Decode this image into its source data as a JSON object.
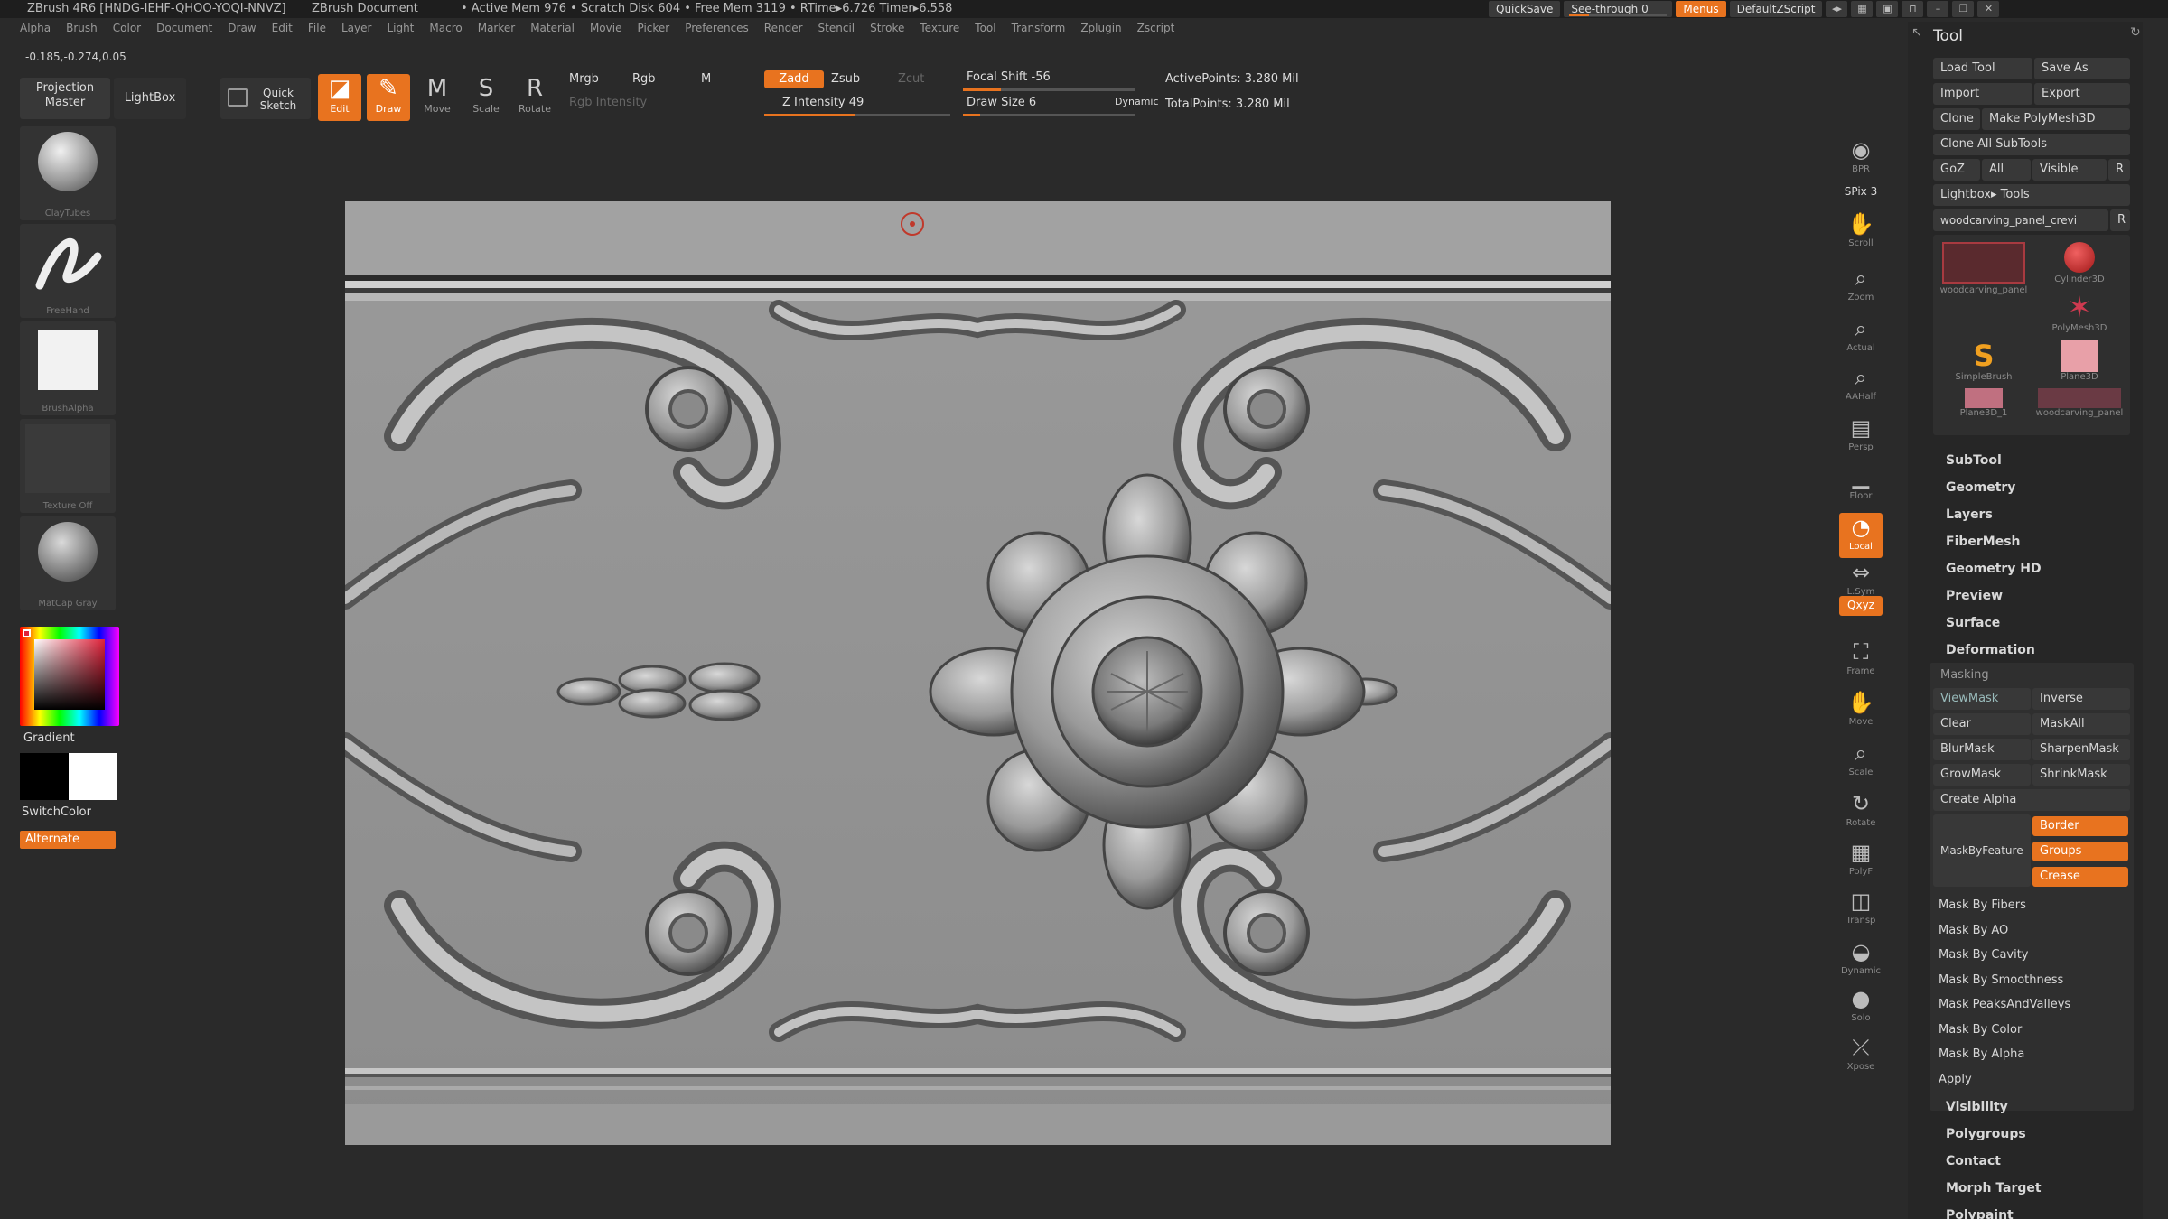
{
  "titlebar": {
    "app": "ZBrush 4R6 [HNDG-IEHF-QHOO-YOQI-NNVZ]",
    "document": "ZBrush Document",
    "memory": "• Active Mem 976 • Scratch Disk 604 • Free Mem 3119 • RTime▸6.726 Timer▸6.558",
    "quicksave": "QuickSave",
    "see_through": "See-through",
    "see_through_value": "0",
    "menus": "Menus",
    "script": "DefaultZScript"
  },
  "menubar": [
    "Alpha",
    "Brush",
    "Color",
    "Document",
    "Draw",
    "Edit",
    "File",
    "Layer",
    "Light",
    "Macro",
    "Marker",
    "Material",
    "Movie",
    "Picker",
    "Preferences",
    "Render",
    "Stencil",
    "Stroke",
    "Texture",
    "Tool",
    "Transform",
    "Zplugin",
    "Zscript"
  ],
  "coords": "-0.185,-0.274,0.05",
  "shelf": {
    "projection_master": "Projection Master",
    "lightbox": "LightBox",
    "quick_sketch": "Quick Sketch",
    "edit": "Edit",
    "draw": "Draw",
    "move": "Move",
    "scale": "Scale",
    "rotate": "Rotate",
    "mrgb": "Mrgb",
    "rgb": "Rgb",
    "m": "M",
    "rgb_intensity": "Rgb Intensity",
    "zadd": "Zadd",
    "zsub": "Zsub",
    "zcut": "Zcut",
    "z_intensity": "Z Intensity 49",
    "focal_shift": "Focal Shift -56",
    "draw_size": "Draw Size 6",
    "dynamic": "Dynamic",
    "active_points": "ActivePoints: 3.280 Mil",
    "total_points": "TotalPoints: 3.280 Mil",
    "z_intensity_value": 0.49,
    "focal_shift_value": -0.56,
    "draw_size_value": 0.03
  },
  "lefttray": {
    "brush": "ClayTubes",
    "stroke": "FreeHand",
    "alpha": "BrushAlpha",
    "texture": "Texture Off",
    "material": "MatCap Gray",
    "gradient": "Gradient",
    "switchcolor": "SwitchColor",
    "alternate": "Alternate"
  },
  "rtoolbar": [
    {
      "label": "BPR",
      "icon": "bpr-icon"
    },
    {
      "label": "SPix 3",
      "icon": "spix-icon"
    },
    {
      "label": "Scroll",
      "icon": "scroll-icon"
    },
    {
      "label": "Zoom",
      "icon": "zoom-icon"
    },
    {
      "label": "Actual",
      "icon": "actual-icon"
    },
    {
      "label": "AAHalf",
      "icon": "aahalf-icon"
    },
    {
      "label": "Persp",
      "icon": "persp-icon"
    },
    {
      "label": "Floor",
      "icon": "floor-icon"
    },
    {
      "label": "Local",
      "icon": "local-icon"
    },
    {
      "label": "L.Sym",
      "icon": "lsym-icon"
    },
    {
      "label": "Qxyz",
      "icon": "xyz-icon"
    },
    {
      "label": "Frame",
      "icon": "frame-icon"
    },
    {
      "label": "Move",
      "icon": "move-icon"
    },
    {
      "label": "Scale",
      "icon": "scale-icon"
    },
    {
      "label": "Rotate",
      "icon": "rotate-icon"
    },
    {
      "label": "PolyF",
      "icon": "polyf-icon"
    },
    {
      "label": "Transp",
      "icon": "transp-icon"
    },
    {
      "label": "Dynamic",
      "icon": "dynamic-icon"
    },
    {
      "label": "Solo",
      "icon": "solo-icon"
    },
    {
      "label": "Xpose",
      "icon": "xpose-icon"
    }
  ],
  "toolpanel": {
    "title": "Tool",
    "load_tool": "Load Tool",
    "save_as": "Save As",
    "import": "Import",
    "export": "Export",
    "clone": "Clone",
    "make_polymesh": "Make PolyMesh3D",
    "clone_all": "Clone All SubTools",
    "goz": "GoZ",
    "all": "All",
    "visible": "Visible",
    "r": "R",
    "lightbox_tools": "Lightbox▸ Tools",
    "current_tool": "woodcarving_panel_crevi",
    "thumbs": [
      "woodcarving_panel",
      "Cylinder3D",
      "PolyMesh3D",
      "SimpleBrush",
      "Plane3D",
      "Plane3D_1",
      "woodcarving_panel"
    ],
    "sections_top": [
      "SubTool",
      "Geometry",
      "Layers",
      "FiberMesh",
      "Geometry HD",
      "Preview",
      "Surface",
      "Deformation"
    ],
    "masking": "Masking",
    "viewmask": "ViewMask",
    "inverse": "Inverse",
    "clear": "Clear",
    "maskall": "MaskAll",
    "blurmask": "BlurMask",
    "sharpenmask": "SharpenMask",
    "growmask": "GrowMask",
    "shrinkmask": "ShrinkMask",
    "create_alpha": "Create Alpha",
    "maskbyfeature": "MaskByFeature",
    "border": "Border",
    "groups": "Groups",
    "crease": "Crease",
    "mask_list": [
      "Mask By Fibers",
      "Mask By AO",
      "Mask By Cavity",
      "Mask By Smoothness",
      "Mask PeaksAndValleys",
      "Mask By Color",
      "Mask By Alpha",
      "Apply"
    ],
    "sections_bottom": [
      "Visibility",
      "Polygroups",
      "Contact",
      "Morph Target",
      "Polypaint"
    ]
  },
  "colors": {
    "accent": "#e8731f",
    "panel": "#262626",
    "button": "#383838"
  }
}
